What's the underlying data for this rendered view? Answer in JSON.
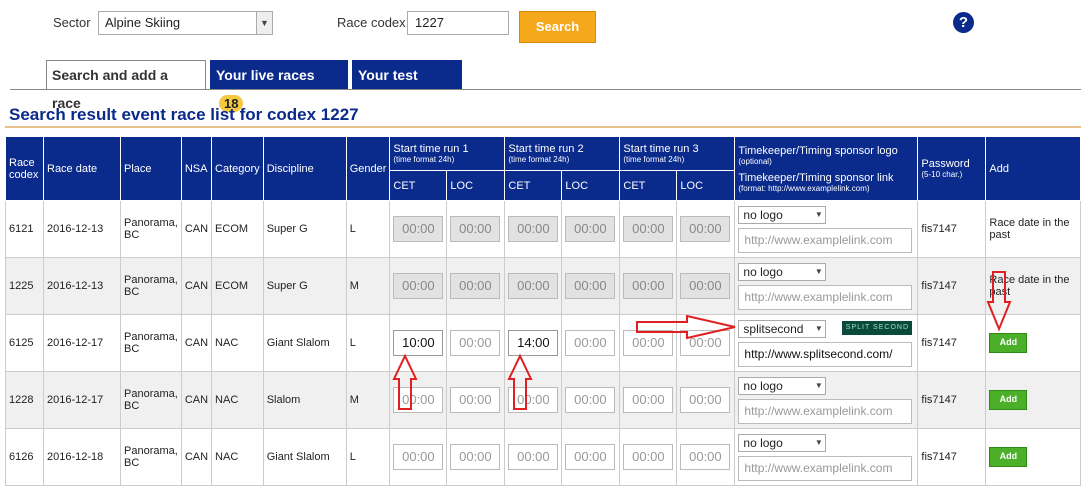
{
  "filters": {
    "sector_label": "Sector",
    "sector_value": "Alpine Skiing",
    "codex_label": "Race codex",
    "codex_value": "1227",
    "search_label": "Search",
    "help": "?"
  },
  "tabs": [
    {
      "label": "Search and add a race"
    },
    {
      "label": "Your live races",
      "badge": "18"
    },
    {
      "label": "Your test races"
    }
  ],
  "heading": "Search result event race list for codex 1227",
  "columns": {
    "race_codex": "Race codex",
    "race_date": "Race date",
    "place": "Place",
    "nsa": "NSA",
    "category": "Category",
    "discipline": "Discipline",
    "gender": "Gender",
    "run1": "Start time run 1",
    "run2": "Start time run 2",
    "run3": "Start time run 3",
    "time_format": "(time format 24h)",
    "cet": "CET",
    "loc": "LOC",
    "timekeeper": "Timekeeper/Timing sponsor logo",
    "optional": "(optional)",
    "timekeeper_link": "Timekeeper/Timing sponsor link",
    "link_format": "(format: http://www.examplelink.com)",
    "password": "Password",
    "password_hint": "(5-10 char.)",
    "add": "Add"
  },
  "rows": [
    {
      "codex": "6121",
      "date": "2016-12-13",
      "place": "Panorama, BC",
      "nsa": "CAN",
      "category": "ECOM",
      "discipline": "Super G",
      "gender": "L",
      "times": [
        "00:00",
        "00:00",
        "00:00",
        "00:00",
        "00:00",
        "00:00"
      ],
      "logo": "no logo",
      "link": "http://www.examplelink.com",
      "password": "fis7147",
      "add": "Race date in the past"
    },
    {
      "codex": "1225",
      "date": "2016-12-13",
      "place": "Panorama, BC",
      "nsa": "CAN",
      "category": "ECOM",
      "discipline": "Super G",
      "gender": "M",
      "times": [
        "00:00",
        "00:00",
        "00:00",
        "00:00",
        "00:00",
        "00:00"
      ],
      "logo": "no logo",
      "link": "http://www.examplelink.com",
      "password": "fis7147",
      "add": "Race date in the past"
    },
    {
      "codex": "6125",
      "date": "2016-12-17",
      "place": "Panorama, BC",
      "nsa": "CAN",
      "category": "NAC",
      "discipline": "Giant Slalom",
      "gender": "L",
      "times": [
        "10:00",
        "00:00",
        "14:00",
        "00:00",
        "00:00",
        "00:00"
      ],
      "logo": "splitsecond",
      "logo_image_text": "SPLIT SECOND",
      "link": "http://www.splitsecond.com/",
      "password": "fis7147",
      "add": "Add"
    },
    {
      "codex": "1228",
      "date": "2016-12-17",
      "place": "Panorama, BC",
      "nsa": "CAN",
      "category": "NAC",
      "discipline": "Slalom",
      "gender": "M",
      "times": [
        "00:00",
        "00:00",
        "00:00",
        "00:00",
        "00:00",
        "00:00"
      ],
      "logo": "no logo",
      "link": "http://www.examplelink.com",
      "password": "fis7147",
      "add": "Add"
    },
    {
      "codex": "6126",
      "date": "2016-12-18",
      "place": "Panorama, BC",
      "nsa": "CAN",
      "category": "NAC",
      "discipline": "Giant Slalom",
      "gender": "L",
      "times": [
        "00:00",
        "00:00",
        "00:00",
        "00:00",
        "00:00",
        "00:00"
      ],
      "logo": "no logo",
      "link": "http://www.examplelink.com",
      "password": "fis7147",
      "add": "Add"
    }
  ]
}
